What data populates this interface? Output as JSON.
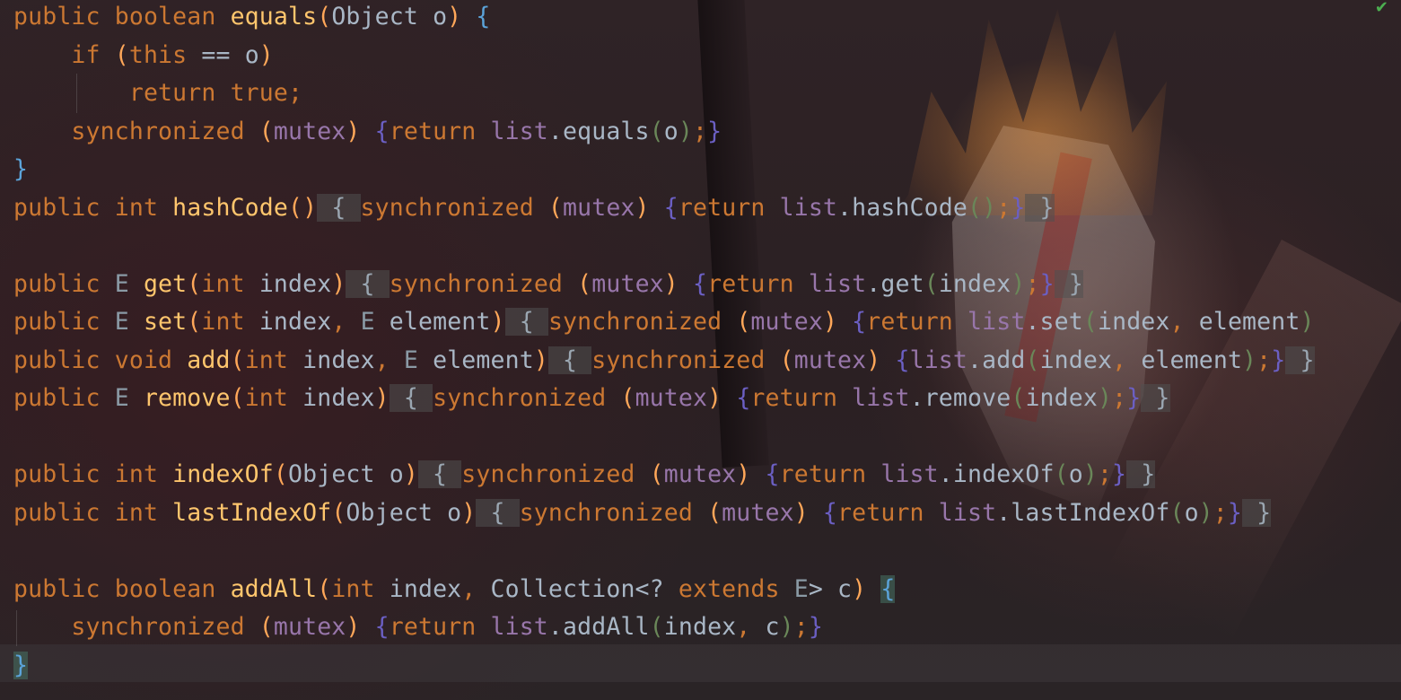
{
  "editor": {
    "status_check": "✔",
    "lines": [
      [
        [
          "k",
          "public boolean "
        ],
        [
          "m",
          "equals"
        ],
        [
          "b1",
          "("
        ],
        [
          "ty",
          "Object "
        ],
        [
          "p",
          "o"
        ],
        [
          "b1",
          ") "
        ],
        [
          "b2",
          "{"
        ]
      ],
      [
        [
          "k",
          "    if "
        ],
        [
          "b1",
          "("
        ],
        [
          "k",
          "this "
        ],
        [
          "p",
          "== o"
        ],
        [
          "b1",
          ")"
        ]
      ],
      [
        [
          "k",
          "        return true"
        ],
        [
          "punct",
          ";"
        ]
      ],
      [
        [
          "k",
          "    synchronized "
        ],
        [
          "b1",
          "("
        ],
        [
          "f",
          "mutex"
        ],
        [
          "b1",
          ") "
        ],
        [
          "br",
          "{"
        ],
        [
          "k",
          "return "
        ],
        [
          "f",
          "list"
        ],
        [
          "p",
          "."
        ],
        [
          "m2",
          "equals"
        ],
        [
          "b3",
          "("
        ],
        [
          "p",
          "o"
        ],
        [
          "b3",
          ")"
        ],
        [
          "punct",
          ";"
        ],
        [
          "br",
          "}"
        ]
      ],
      [
        [
          "b2",
          "}"
        ]
      ],
      [
        [
          "k",
          "public int "
        ],
        [
          "m",
          "hashCode"
        ],
        [
          "b1",
          "()"
        ],
        [
          "fold",
          " { "
        ],
        [
          "k",
          "synchronized "
        ],
        [
          "b1",
          "("
        ],
        [
          "f",
          "mutex"
        ],
        [
          "b1",
          ") "
        ],
        [
          "br",
          "{"
        ],
        [
          "k",
          "return "
        ],
        [
          "f",
          "list"
        ],
        [
          "p",
          "."
        ],
        [
          "m2",
          "hashCode"
        ],
        [
          "b3",
          "()"
        ],
        [
          "punct",
          ";"
        ],
        [
          "br",
          "}"
        ],
        [
          "fold",
          " }"
        ]
      ],
      [
        [
          "p",
          ""
        ]
      ],
      [
        [
          "k",
          "public "
        ],
        [
          "ty-g",
          "E "
        ],
        [
          "m",
          "get"
        ],
        [
          "b1",
          "("
        ],
        [
          "k",
          "int "
        ],
        [
          "p",
          "index"
        ],
        [
          "b1",
          ")"
        ],
        [
          "fold",
          " { "
        ],
        [
          "k",
          "synchronized "
        ],
        [
          "b1",
          "("
        ],
        [
          "f",
          "mutex"
        ],
        [
          "b1",
          ") "
        ],
        [
          "br",
          "{"
        ],
        [
          "k",
          "return "
        ],
        [
          "f",
          "list"
        ],
        [
          "p",
          "."
        ],
        [
          "m2",
          "get"
        ],
        [
          "b3",
          "("
        ],
        [
          "p",
          "index"
        ],
        [
          "b3",
          ")"
        ],
        [
          "punct",
          ";"
        ],
        [
          "br",
          "}"
        ],
        [
          "fold",
          " }"
        ]
      ],
      [
        [
          "k",
          "public "
        ],
        [
          "ty-g",
          "E "
        ],
        [
          "m",
          "set"
        ],
        [
          "b1",
          "("
        ],
        [
          "k",
          "int "
        ],
        [
          "p",
          "index"
        ],
        [
          "punct",
          ", "
        ],
        [
          "ty-g",
          "E "
        ],
        [
          "p",
          "element"
        ],
        [
          "b1",
          ")"
        ],
        [
          "fold",
          " { "
        ],
        [
          "k",
          "synchronized "
        ],
        [
          "b1",
          "("
        ],
        [
          "f",
          "mutex"
        ],
        [
          "b1",
          ") "
        ],
        [
          "br",
          "{"
        ],
        [
          "k",
          "return "
        ],
        [
          "f",
          "list"
        ],
        [
          "p",
          "."
        ],
        [
          "m2",
          "set"
        ],
        [
          "b3",
          "("
        ],
        [
          "p",
          "index"
        ],
        [
          "punct",
          ", "
        ],
        [
          "p",
          "element"
        ],
        [
          "b3",
          ")"
        ]
      ],
      [
        [
          "k",
          "public void "
        ],
        [
          "m",
          "add"
        ],
        [
          "b1",
          "("
        ],
        [
          "k",
          "int "
        ],
        [
          "p",
          "index"
        ],
        [
          "punct",
          ", "
        ],
        [
          "ty-g",
          "E "
        ],
        [
          "p",
          "element"
        ],
        [
          "b1",
          ")"
        ],
        [
          "fold",
          " { "
        ],
        [
          "k",
          "synchronized "
        ],
        [
          "b1",
          "("
        ],
        [
          "f",
          "mutex"
        ],
        [
          "b1",
          ") "
        ],
        [
          "br",
          "{"
        ],
        [
          "f",
          "list"
        ],
        [
          "p",
          "."
        ],
        [
          "m2",
          "add"
        ],
        [
          "b3",
          "("
        ],
        [
          "p",
          "index"
        ],
        [
          "punct",
          ", "
        ],
        [
          "p",
          "element"
        ],
        [
          "b3",
          ")"
        ],
        [
          "punct",
          ";"
        ],
        [
          "br",
          "}"
        ],
        [
          "fold",
          " }"
        ]
      ],
      [
        [
          "k",
          "public "
        ],
        [
          "ty-g",
          "E "
        ],
        [
          "m",
          "remove"
        ],
        [
          "b1",
          "("
        ],
        [
          "k",
          "int "
        ],
        [
          "p",
          "index"
        ],
        [
          "b1",
          ")"
        ],
        [
          "fold",
          " { "
        ],
        [
          "k",
          "synchronized "
        ],
        [
          "b1",
          "("
        ],
        [
          "f",
          "mutex"
        ],
        [
          "b1",
          ") "
        ],
        [
          "br",
          "{"
        ],
        [
          "k",
          "return "
        ],
        [
          "f",
          "list"
        ],
        [
          "p",
          "."
        ],
        [
          "m2",
          "remove"
        ],
        [
          "b3",
          "("
        ],
        [
          "p",
          "index"
        ],
        [
          "b3",
          ")"
        ],
        [
          "punct",
          ";"
        ],
        [
          "br",
          "}"
        ],
        [
          "fold",
          " }"
        ]
      ],
      [
        [
          "p",
          ""
        ]
      ],
      [
        [
          "k",
          "public int "
        ],
        [
          "m",
          "indexOf"
        ],
        [
          "b1",
          "("
        ],
        [
          "ty",
          "Object "
        ],
        [
          "p",
          "o"
        ],
        [
          "b1",
          ")"
        ],
        [
          "fold",
          " { "
        ],
        [
          "k",
          "synchronized "
        ],
        [
          "b1",
          "("
        ],
        [
          "f",
          "mutex"
        ],
        [
          "b1",
          ") "
        ],
        [
          "br",
          "{"
        ],
        [
          "k",
          "return "
        ],
        [
          "f",
          "list"
        ],
        [
          "p",
          "."
        ],
        [
          "m2",
          "indexOf"
        ],
        [
          "b3",
          "("
        ],
        [
          "p",
          "o"
        ],
        [
          "b3",
          ")"
        ],
        [
          "punct",
          ";"
        ],
        [
          "br",
          "}"
        ],
        [
          "fold",
          " }"
        ]
      ],
      [
        [
          "k",
          "public int "
        ],
        [
          "m",
          "lastIndexOf"
        ],
        [
          "b1",
          "("
        ],
        [
          "ty",
          "Object "
        ],
        [
          "p",
          "o"
        ],
        [
          "b1",
          ")"
        ],
        [
          "fold",
          " { "
        ],
        [
          "k",
          "synchronized "
        ],
        [
          "b1",
          "("
        ],
        [
          "f",
          "mutex"
        ],
        [
          "b1",
          ") "
        ],
        [
          "br",
          "{"
        ],
        [
          "k",
          "return "
        ],
        [
          "f",
          "list"
        ],
        [
          "p",
          "."
        ],
        [
          "m2",
          "lastIndexOf"
        ],
        [
          "b3",
          "("
        ],
        [
          "p",
          "o"
        ],
        [
          "b3",
          ")"
        ],
        [
          "punct",
          ";"
        ],
        [
          "br",
          "}"
        ],
        [
          "fold",
          " }"
        ]
      ],
      [
        [
          "p",
          ""
        ]
      ],
      [
        [
          "k",
          "public boolean "
        ],
        [
          "m",
          "addAll"
        ],
        [
          "b1",
          "("
        ],
        [
          "k",
          "int "
        ],
        [
          "p",
          "index"
        ],
        [
          "punct",
          ", "
        ],
        [
          "ty",
          "Collection<? "
        ],
        [
          "k",
          "extends "
        ],
        [
          "ty-g",
          "E"
        ],
        [
          "ty",
          "> "
        ],
        [
          "p",
          "c"
        ],
        [
          "b1",
          ") "
        ],
        [
          "hl",
          "{"
        ]
      ],
      [
        [
          "k",
          "    synchronized "
        ],
        [
          "b1",
          "("
        ],
        [
          "f",
          "mutex"
        ],
        [
          "b1",
          ") "
        ],
        [
          "br",
          "{"
        ],
        [
          "k",
          "return "
        ],
        [
          "f",
          "list"
        ],
        [
          "p",
          "."
        ],
        [
          "m2",
          "addAll"
        ],
        [
          "b3",
          "("
        ],
        [
          "p",
          "index"
        ],
        [
          "punct",
          ", "
        ],
        [
          "p",
          "c"
        ],
        [
          "b3",
          ")"
        ],
        [
          "punct",
          ";"
        ],
        [
          "br",
          "}"
        ]
      ],
      [
        [
          "hl2",
          "}"
        ]
      ]
    ]
  }
}
